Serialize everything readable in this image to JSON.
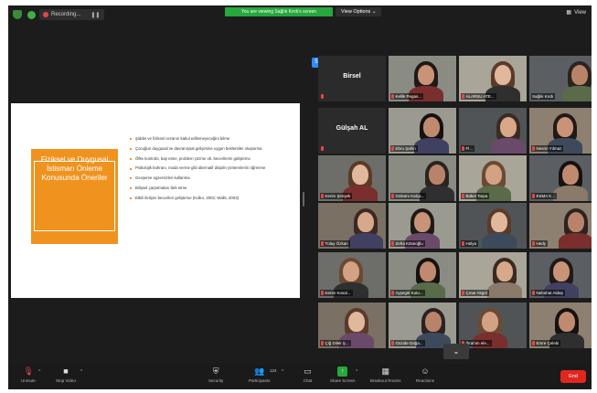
{
  "topbar": {
    "recording_label": "Recording...",
    "viewing_banner": "You are viewing Sağlık Kırdı's screen",
    "view_options": "View Options",
    "view_label": "View"
  },
  "slide": {
    "box_title": "Fiziksel ve Duygusal İstismarı Önleme Konusunda Öneriler",
    "bullets": [
      "Şiddet ve fiziksel cezanın kabul edilemeyeceğini bilme",
      "Çocuğun duygusal ve davranışsal gelişimine uygun beklentiler oluşturma",
      "Öfke kontrolü, baş etme, problem çözme vb. becerilerini geliştirme",
      "Psikolojik buhranı, moda verme gibi alternatif disiplin yöntemlerini öğrenme",
      "Gevşeme egzersizleri kullanma",
      "Bilişsel çarpıtmaları fark etme",
      "Etkili iletişim becerileri geliştirme (Kolko, 2002; Walls, 2003)"
    ]
  },
  "participants": [
    {
      "label": "",
      "center_name": "Birsel",
      "muted": true
    },
    {
      "label": "Kellik Pegas...",
      "muted": true
    },
    {
      "label": "ALARSU ATE...",
      "muted": true
    },
    {
      "label": "Sağlık Kırdı",
      "muted": false
    },
    {
      "label": "",
      "center_name": "Gülşah AL",
      "muted": true
    },
    {
      "label": "Ebru Şahin",
      "muted": true
    },
    {
      "label": "Fl...",
      "muted": true
    },
    {
      "label": "Nesrin Yılmaz",
      "muted": true
    },
    {
      "label": "Kerim Şimşek",
      "muted": true
    },
    {
      "label": "Gülsüm Kalça...",
      "muted": true
    },
    {
      "label": "Büket Tarpa",
      "muted": true
    },
    {
      "label": "ESMA K...",
      "muted": true
    },
    {
      "label": "Tülay Özkan",
      "muted": true
    },
    {
      "label": "Zeha Köseoğlu",
      "muted": true
    },
    {
      "label": "Hülya",
      "muted": true
    },
    {
      "label": "Hedy",
      "muted": true
    },
    {
      "label": "Kerim Kosal...",
      "muted": true
    },
    {
      "label": "Ayşegül Kutu...",
      "muted": true
    },
    {
      "label": "Çınar Akgül",
      "muted": true
    },
    {
      "label": "Nebahat Aldaş",
      "muted": true
    },
    {
      "label": "Çiğ Dilek Ş...",
      "muted": true
    },
    {
      "label": "Güzide Dağa...",
      "muted": true
    },
    {
      "label": "İbrahim ele...",
      "muted": true
    },
    {
      "label": "Emre Çelebi",
      "muted": true
    }
  ],
  "toolbar": {
    "unmute": "Unmute",
    "stop_video": "Stop Video",
    "security": "Security",
    "participants": "Participants",
    "participants_count": "124",
    "chat": "Chat",
    "share_screen": "Share Screen",
    "breakout_rooms": "Breakout Rooms",
    "reactions": "Reactions",
    "end": "End"
  },
  "colors": {
    "accent_green": "#25a83c",
    "active_speaker": "#c8d84a",
    "slide_orange": "#f0931e",
    "end_red": "#e0271f"
  }
}
